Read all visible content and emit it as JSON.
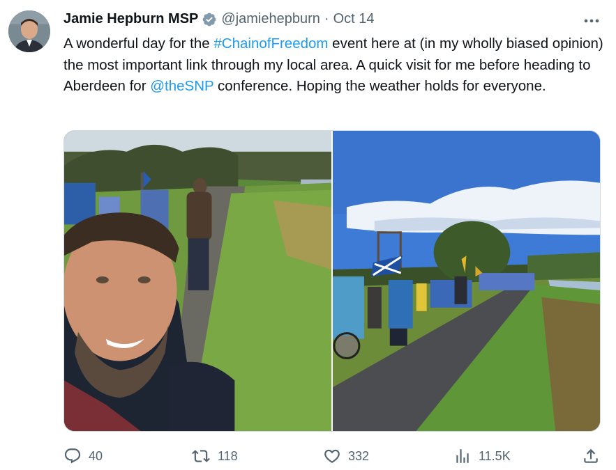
{
  "author": {
    "name": "Jamie Hepburn MSP",
    "handle": "@jamiehepburn",
    "separator": "·",
    "time": "Oct 14"
  },
  "tweet": {
    "text_1": "A wonderful day for the ",
    "hashtag": "#ChainofFreedom",
    "text_2": " event here at (in my wholly biased opinion) the most important link through my local area. A quick visit for me before heading to Aberdeen for ",
    "mention": "@theSNP",
    "text_3": " conference. Hoping the weather holds for everyone."
  },
  "actions": {
    "replies": "40",
    "retweets": "118",
    "likes": "332",
    "views": "11.5K"
  },
  "colors": {
    "link": "#1d9bf0",
    "verified": "#829aab",
    "secondary_text": "#536471",
    "primary_text": "#0f1419"
  },
  "icons": [
    "verified-badge-icon",
    "more-icon",
    "reply-icon",
    "retweet-icon",
    "like-icon",
    "views-icon",
    "share-icon"
  ]
}
